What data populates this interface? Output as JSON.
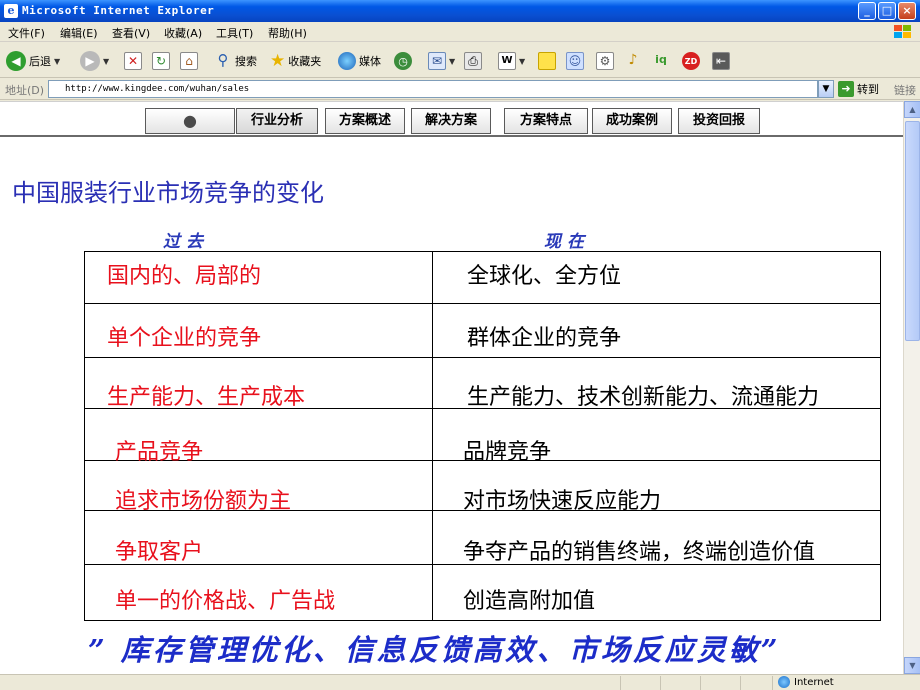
{
  "window": {
    "title": "Microsoft Internet Explorer",
    "app_icon": "e",
    "minimize": "_",
    "maximize": "□",
    "close": "×"
  },
  "menubar": {
    "items": [
      "文件(F)",
      "编辑(E)",
      "查看(V)",
      "收藏(A)",
      "工具(T)",
      "帮助(H)"
    ],
    "logo": "xp-flag-icon"
  },
  "toolbar": {
    "back": "后退",
    "search": "搜索",
    "favorites": "收藏夹",
    "media": "媒体",
    "icons": [
      "back-arrow-icon",
      "forward-arrow-icon",
      "stop-icon",
      "refresh-icon",
      "home-icon",
      "search-icon",
      "favorites-star-icon",
      "media-globe-icon",
      "history-icon",
      "mail-icon",
      "print-icon",
      "edit-icon",
      "note-icon",
      "messenger-icon",
      "settings-icon",
      "plugin-icon",
      "iqiyi-icon",
      "toolbar-logo-icon",
      "exit-icon"
    ]
  },
  "address": {
    "label": "地址(D)",
    "url": "http://www.kingdee.com/wuhan/sales",
    "go": "转到",
    "links": "链接"
  },
  "nav": {
    "tabs": [
      "",
      "行业分析",
      "方案概述",
      "解决方案",
      "方案特点",
      "成功案例",
      "投资回报"
    ],
    "active_index": 1
  },
  "slide": {
    "title": "中国服装行业市场竞争的变化",
    "col_past": "过去",
    "col_now": "现在",
    "rows": [
      {
        "past": "国内的、局部的",
        "now": "全球化、全方位"
      },
      {
        "past": "单个企业的竞争",
        "now": "群体企业的竞争"
      },
      {
        "past": "生产能力、生产成本",
        "now": "生产能力、技术创新能力、流通能力"
      },
      {
        "past": "产品竞争",
        "now": "品牌竞争"
      },
      {
        "past": "追求市场份额为主",
        "now": "对市场快速反应能力"
      },
      {
        "past": "争取客户",
        "now": "争夺产品的销售终端，终端创造价值"
      },
      {
        "past": "单一的价格战、广告战",
        "now": "创造高附加值"
      }
    ],
    "footer": "” 库存管理优化、信息反馈高效、市场反应灵敏”"
  },
  "status": {
    "zone": "Internet"
  },
  "colors": {
    "title_blue": "#2a2fb4",
    "past_red": "#e8101c",
    "footer_blue": "#1c2cc8",
    "xp_titlebar": "#0a4fd1"
  }
}
